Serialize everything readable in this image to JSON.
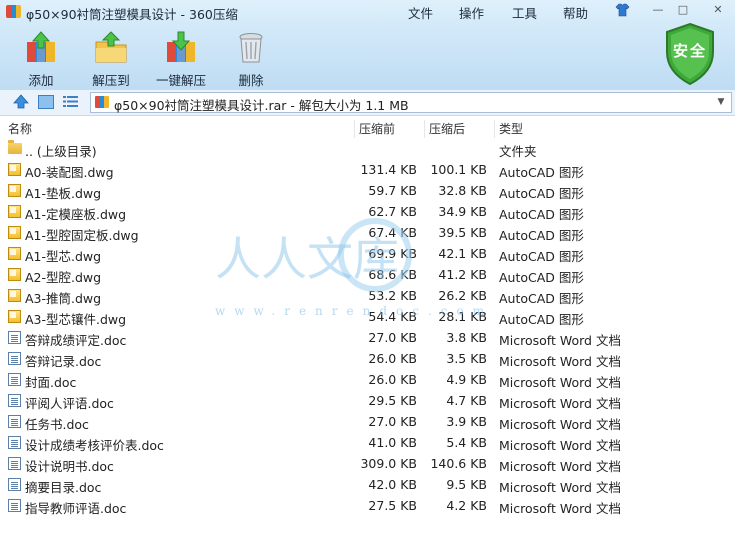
{
  "window": {
    "title": "φ50×90衬筒注塑模具设计 - 360压缩",
    "menu": [
      "文件",
      "操作",
      "工具",
      "帮助"
    ],
    "controls": {
      "minimize": "—",
      "maximize": "□",
      "close": "✕"
    }
  },
  "toolbar": {
    "add_label": "添加",
    "extract_to_label": "解压到",
    "one_click_extract_label": "一键解压",
    "delete_label": "删除",
    "security_badge": "安全"
  },
  "address_bar": {
    "path": "φ50×90衬筒注塑模具设计.rar - 解包大小为 1.1 MB"
  },
  "columns": {
    "name": "名称",
    "size": "压缩前",
    "compressed": "压缩后",
    "type": "类型"
  },
  "watermark": {
    "text_main": "人人文库",
    "text_url": "www.renrendoc.com"
  },
  "files": [
    {
      "icon": "folder",
      "name": ".. (上级目录)",
      "size": "",
      "compressed": "",
      "type": "文件夹"
    },
    {
      "icon": "dwg",
      "name": "A0-装配图.dwg",
      "size": "131.4 KB",
      "compressed": "100.1 KB",
      "type": "AutoCAD 图形"
    },
    {
      "icon": "dwg",
      "name": "A1-垫板.dwg",
      "size": "59.7 KB",
      "compressed": "32.8 KB",
      "type": "AutoCAD 图形"
    },
    {
      "icon": "dwg",
      "name": "A1-定模座板.dwg",
      "size": "62.7 KB",
      "compressed": "34.9 KB",
      "type": "AutoCAD 图形"
    },
    {
      "icon": "dwg",
      "name": "A1-型腔固定板.dwg",
      "size": "67.4 KB",
      "compressed": "39.5 KB",
      "type": "AutoCAD 图形"
    },
    {
      "icon": "dwg",
      "name": "A1-型芯.dwg",
      "size": "69.9 KB",
      "compressed": "42.1 KB",
      "type": "AutoCAD 图形"
    },
    {
      "icon": "dwg",
      "name": "A2-型腔.dwg",
      "size": "68.6 KB",
      "compressed": "41.2 KB",
      "type": "AutoCAD 图形"
    },
    {
      "icon": "dwg",
      "name": "A3-推筒.dwg",
      "size": "53.2 KB",
      "compressed": "26.2 KB",
      "type": "AutoCAD 图形"
    },
    {
      "icon": "dwg",
      "name": "A3-型芯镶件.dwg",
      "size": "54.4 KB",
      "compressed": "28.1 KB",
      "type": "AutoCAD 图形"
    },
    {
      "icon": "doc",
      "name": "答辩成绩评定.doc",
      "size": "27.0 KB",
      "compressed": "3.8 KB",
      "type": "Microsoft Word 文档"
    },
    {
      "icon": "doc",
      "name": "答辩记录.doc",
      "size": "26.0 KB",
      "compressed": "3.5 KB",
      "type": "Microsoft Word 文档"
    },
    {
      "icon": "doc",
      "name": "封面.doc",
      "size": "26.0 KB",
      "compressed": "4.9 KB",
      "type": "Microsoft Word 文档"
    },
    {
      "icon": "doc",
      "name": "评阅人评语.doc",
      "size": "29.5 KB",
      "compressed": "4.7 KB",
      "type": "Microsoft Word 文档"
    },
    {
      "icon": "doc",
      "name": "任务书.doc",
      "size": "27.0 KB",
      "compressed": "3.9 KB",
      "type": "Microsoft Word 文档"
    },
    {
      "icon": "doc",
      "name": "设计成绩考核评价表.doc",
      "size": "41.0 KB",
      "compressed": "5.4 KB",
      "type": "Microsoft Word 文档"
    },
    {
      "icon": "doc",
      "name": "设计说明书.doc",
      "size": "309.0 KB",
      "compressed": "140.6 KB",
      "type": "Microsoft Word 文档"
    },
    {
      "icon": "doc",
      "name": "摘要目录.doc",
      "size": "42.0 KB",
      "compressed": "9.5 KB",
      "type": "Microsoft Word 文档"
    },
    {
      "icon": "doc",
      "name": "指导教师评语.doc",
      "size": "27.5 KB",
      "compressed": "4.2 KB",
      "type": "Microsoft Word 文档"
    }
  ]
}
